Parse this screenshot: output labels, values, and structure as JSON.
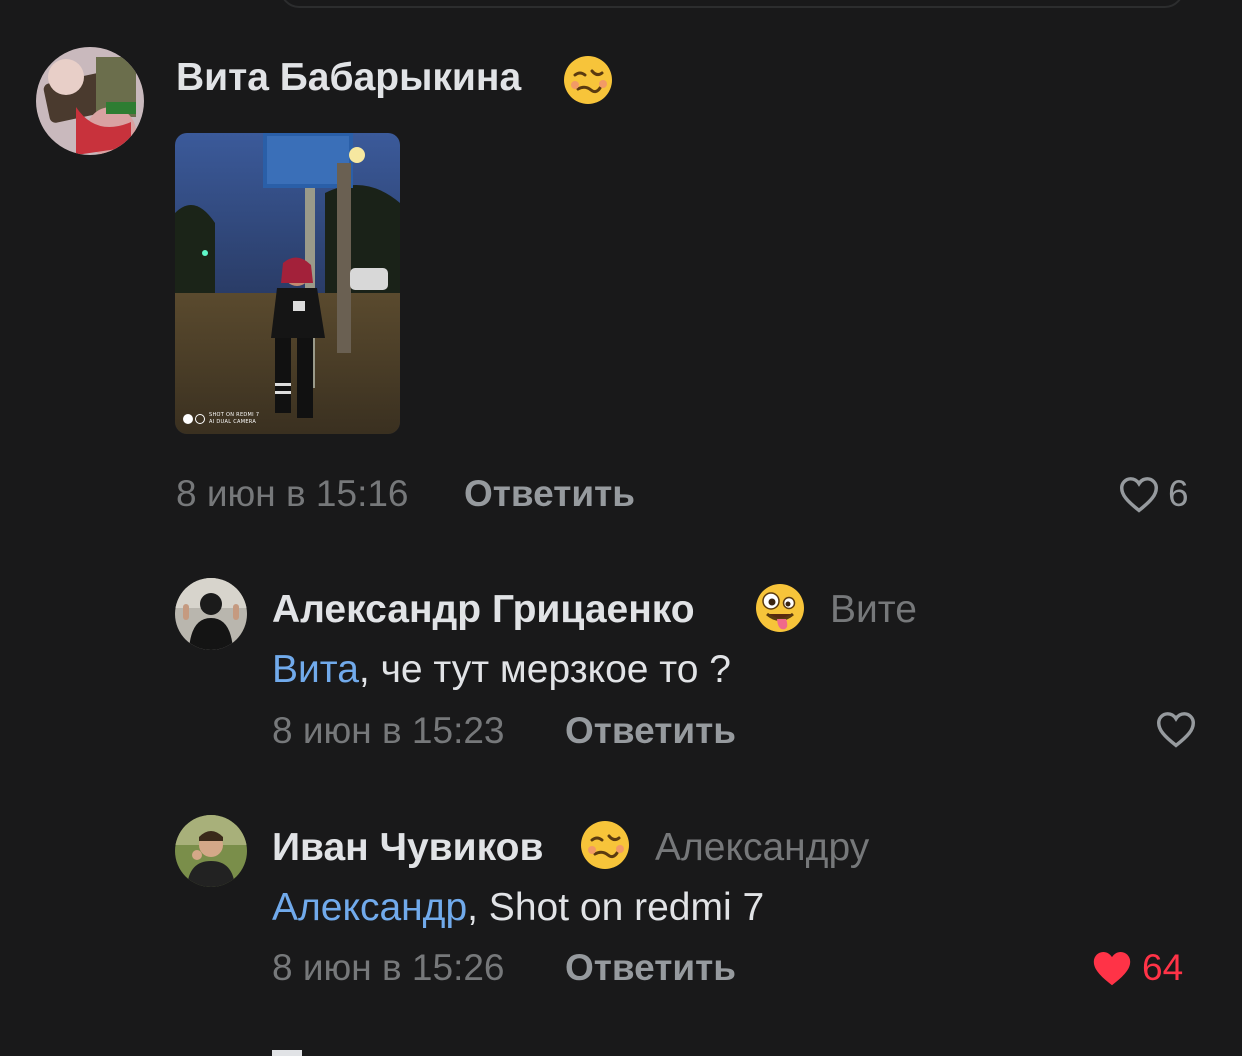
{
  "comments": [
    {
      "author": "Вита Бабарыкина",
      "time": "8 июн в 15:16",
      "reply_label": "Ответить",
      "likes": "6",
      "liked": false,
      "attachment": {
        "watermark_line1": "SHOT ON REDMI 7",
        "watermark_line2": "AI DUAL CAMERA"
      }
    },
    {
      "author": "Александр Грицаенко",
      "reply_to": "Вите",
      "mention": "Вита",
      "text": ", че тут мерзкое то ?",
      "time": "8 июн в 15:23",
      "reply_label": "Ответить",
      "likes": "",
      "liked": false
    },
    {
      "author": "Иван Чувиков",
      "reply_to": "Александру",
      "mention": "Александр",
      "text": ", Shot on redmi 7",
      "time": "8 июн в 15:26",
      "reply_label": "Ответить",
      "likes": "64",
      "liked": true
    }
  ],
  "icons": {
    "emoji_1": "woozy-face-emoji",
    "emoji_2": "zany-face-emoji",
    "emoji_3": "woozy-face-emoji",
    "like": "heart-icon"
  },
  "colors": {
    "background": "#19191a",
    "mention": "#71aaeb",
    "liked": "#ff3347",
    "secondary": "#76787a"
  }
}
